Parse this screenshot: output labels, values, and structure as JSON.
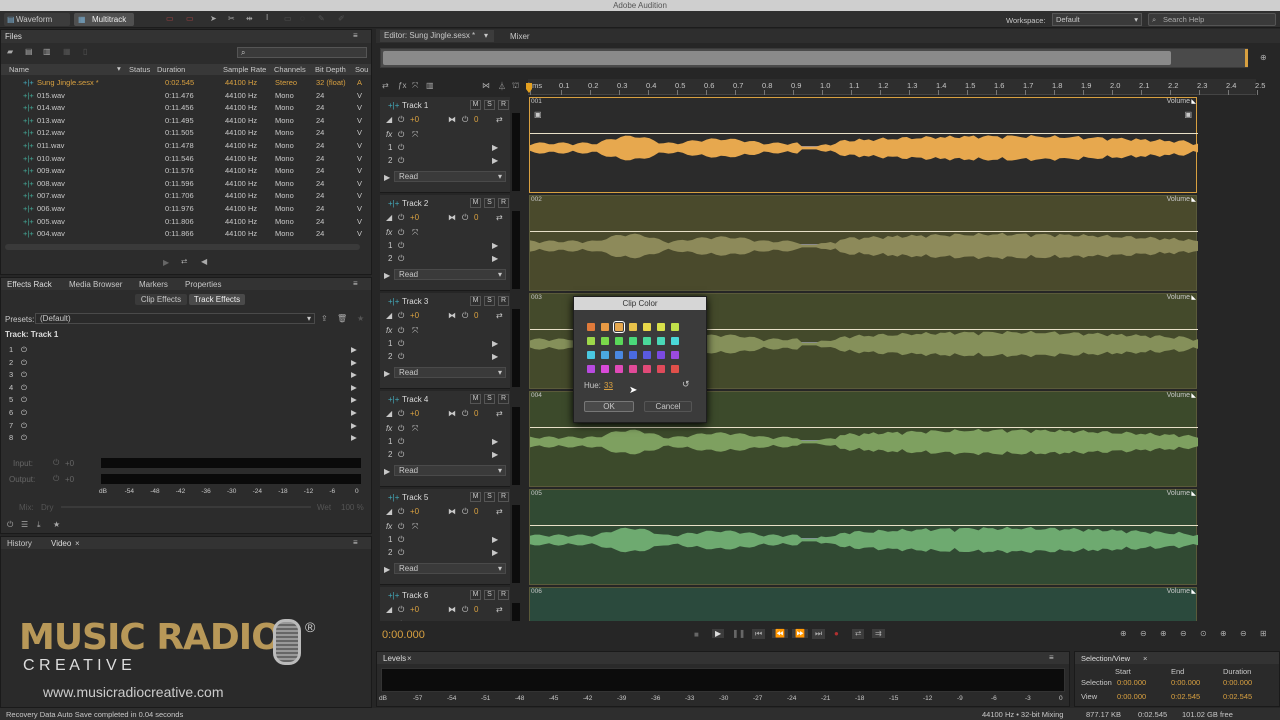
{
  "app": {
    "title": "Adobe Audition",
    "workspace_label": "Workspace:",
    "workspace_value": "Default",
    "search_placeholder": "Search Help"
  },
  "toolbar": {
    "waveform": "Waveform",
    "multitrack": "Multitrack"
  },
  "files": {
    "tab": "Files",
    "columns": [
      "Name",
      "Status",
      "Duration",
      "Sample Rate",
      "Channels",
      "Bit Depth",
      "Sou"
    ],
    "rows": [
      {
        "name": "Sung Jingle.sesx *",
        "duration": "0:02.545",
        "rate": "44100 Hz",
        "channels": "Stereo",
        "depth": "32 (float)",
        "src": "A"
      },
      {
        "name": "015.wav",
        "duration": "0:11.476",
        "rate": "44100 Hz",
        "channels": "Mono",
        "depth": "24",
        "src": "V"
      },
      {
        "name": "014.wav",
        "duration": "0:11.456",
        "rate": "44100 Hz",
        "channels": "Mono",
        "depth": "24",
        "src": "V"
      },
      {
        "name": "013.wav",
        "duration": "0:11.495",
        "rate": "44100 Hz",
        "channels": "Mono",
        "depth": "24",
        "src": "V"
      },
      {
        "name": "012.wav",
        "duration": "0:11.505",
        "rate": "44100 Hz",
        "channels": "Mono",
        "depth": "24",
        "src": "V"
      },
      {
        "name": "011.wav",
        "duration": "0:11.478",
        "rate": "44100 Hz",
        "channels": "Mono",
        "depth": "24",
        "src": "V"
      },
      {
        "name": "010.wav",
        "duration": "0:11.546",
        "rate": "44100 Hz",
        "channels": "Mono",
        "depth": "24",
        "src": "V"
      },
      {
        "name": "009.wav",
        "duration": "0:11.576",
        "rate": "44100 Hz",
        "channels": "Mono",
        "depth": "24",
        "src": "V"
      },
      {
        "name": "008.wav",
        "duration": "0:11.596",
        "rate": "44100 Hz",
        "channels": "Mono",
        "depth": "24",
        "src": "V"
      },
      {
        "name": "007.wav",
        "duration": "0:11.706",
        "rate": "44100 Hz",
        "channels": "Mono",
        "depth": "24",
        "src": "V"
      },
      {
        "name": "006.wav",
        "duration": "0:11.976",
        "rate": "44100 Hz",
        "channels": "Mono",
        "depth": "24",
        "src": "V"
      },
      {
        "name": "005.wav",
        "duration": "0:11.806",
        "rate": "44100 Hz",
        "channels": "Mono",
        "depth": "24",
        "src": "V"
      },
      {
        "name": "004.wav",
        "duration": "0:11.866",
        "rate": "44100 Hz",
        "channels": "Mono",
        "depth": "24",
        "src": "V"
      }
    ]
  },
  "effects": {
    "tabs": [
      "Effects Rack",
      "Media Browser",
      "Markers",
      "Properties"
    ],
    "clip_effects": "Clip Effects",
    "track_effects": "Track Effects",
    "presets_label": "Presets:",
    "presets_value": "(Default)",
    "track_label": "Track: Track 1",
    "slots": [
      "1",
      "2",
      "3",
      "4",
      "5",
      "6",
      "7",
      "8"
    ],
    "input": "Input:",
    "output": "Output:",
    "db0": "+0",
    "mix": "Mix:",
    "dry": "Dry",
    "wet": "Wet",
    "pct": "100 %",
    "scale": [
      "dB",
      "-54",
      "-48",
      "-42",
      "-36",
      "-30",
      "-24",
      "-18",
      "-12",
      "-6",
      "0"
    ]
  },
  "history": {
    "tabs": [
      "History",
      "Video"
    ]
  },
  "logo": {
    "top": "MUSIC RADIO",
    "bottom": "C R E A T I V E",
    "reg": "®",
    "url": "www.musicradiocreative.com"
  },
  "editor": {
    "tab": "Editor: Sung Jingle.sesx *",
    "mixer": "Mixer",
    "time": "0:00.000"
  },
  "ruler": {
    "labels": [
      "hms",
      "0.1",
      "0.2",
      "0.3",
      "0.4",
      "0.5",
      "0.6",
      "0.7",
      "0.8",
      "0.9",
      "1.0",
      "1.1",
      "1.2",
      "1.3",
      "1.4",
      "1.5",
      "1.6",
      "1.7",
      "1.8",
      "1.9",
      "2.0",
      "2.1",
      "2.2",
      "2.3",
      "2.4",
      "2.5"
    ]
  },
  "tracks": [
    {
      "name": "Track 1",
      "clip": "001",
      "color": "#e7a84e",
      "bg": "#2b2b2b"
    },
    {
      "name": "Track 2",
      "clip": "002",
      "color": "#8d8a5a",
      "bg": "#4a4a2c"
    },
    {
      "name": "Track 3",
      "clip": "003",
      "color": "#85905a",
      "bg": "#444a2b"
    },
    {
      "name": "Track 4",
      "clip": "004",
      "color": "#7ea060",
      "bg": "#3c4a2b"
    },
    {
      "name": "Track 5",
      "clip": "005",
      "color": "#6eaa70",
      "bg": "#314a33"
    },
    {
      "name": "Track 6",
      "clip": "006",
      "color": "#5ea080",
      "bg": "#2b4a3d"
    }
  ],
  "track_common": {
    "vol": "+0",
    "pan": "0",
    "read": "Read",
    "volume": "Volume",
    "m": "M",
    "s": "S",
    "r": "R",
    "send1": "1",
    "send2": "2",
    "fx": "fx"
  },
  "dialog": {
    "title": "Clip Color",
    "hue_label": "Hue:",
    "hue_value": "33",
    "ok": "OK",
    "cancel": "Cancel",
    "swatches": [
      "#e07a3a",
      "#e89a44",
      "#e7a84e",
      "#e9c24a",
      "#e9d84a",
      "#d8e04a",
      "#c0e04a",
      "#9ed84a",
      "#7ad84a",
      "#5ad85a",
      "#4ad87a",
      "#4ad89a",
      "#4ad8b8",
      "#4ad8d8",
      "#4ac8e0",
      "#4aa8e0",
      "#4a88e0",
      "#4a6ae0",
      "#5a5ae0",
      "#7a4ae0",
      "#9a4ae0",
      "#b84ae0",
      "#d84ad8",
      "#e04ab8",
      "#e04a98",
      "#e04a78",
      "#e04a5a",
      "#e0504a"
    ]
  },
  "levels": {
    "tab": "Levels",
    "scale": [
      "dB",
      "-57",
      "-54",
      "-51",
      "-48",
      "-45",
      "-42",
      "-39",
      "-36",
      "-33",
      "-30",
      "-27",
      "-24",
      "-21",
      "-18",
      "-15",
      "-12",
      "-9",
      "-6",
      "-3",
      "0"
    ]
  },
  "selection": {
    "tab": "Selection/View",
    "start": "Start",
    "end": "End",
    "duration": "Duration",
    "sel_label": "Selection",
    "sel_start": "0:00.000",
    "sel_end": "0:00.000",
    "sel_dur": "0:00.000",
    "view_label": "View",
    "view_start": "0:00.000",
    "view_end": "0:02.545",
    "view_dur": "0:02.545"
  },
  "status": {
    "left": "Recovery Data Auto Save completed in 0.04 seconds",
    "rate": "44100 Hz • 32-bit Mixing",
    "size": "877.17 KB",
    "dur": "0:02.545",
    "free": "101.02 GB free"
  }
}
